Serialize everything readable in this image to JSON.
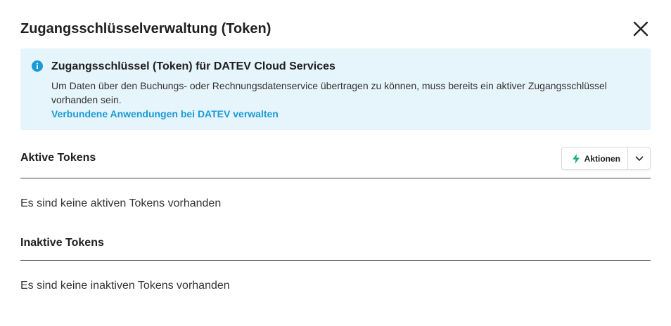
{
  "dialog": {
    "title": "Zugangsschlüsselverwaltung (Token)"
  },
  "info": {
    "title": "Zugangsschlüssel (Token) für DATEV Cloud Services",
    "text": "Um Daten über den Buchungs- oder Rechnungsdatenservice übertragen zu können, muss bereits ein aktiver Zugangsschlüssel vorhanden sein.",
    "link": "Verbundene Anwendungen bei DATEV verwalten"
  },
  "active": {
    "title": "Aktive Tokens",
    "actions_label": "Aktionen",
    "empty": "Es sind keine aktiven Tokens vorhanden"
  },
  "inactive": {
    "title": "Inaktive Tokens",
    "empty": "Es sind keine inaktiven Tokens vorhanden"
  },
  "colors": {
    "info_bg": "#e6f4fb",
    "accent": "#1a9bd7",
    "bolt": "#1eab7c"
  }
}
